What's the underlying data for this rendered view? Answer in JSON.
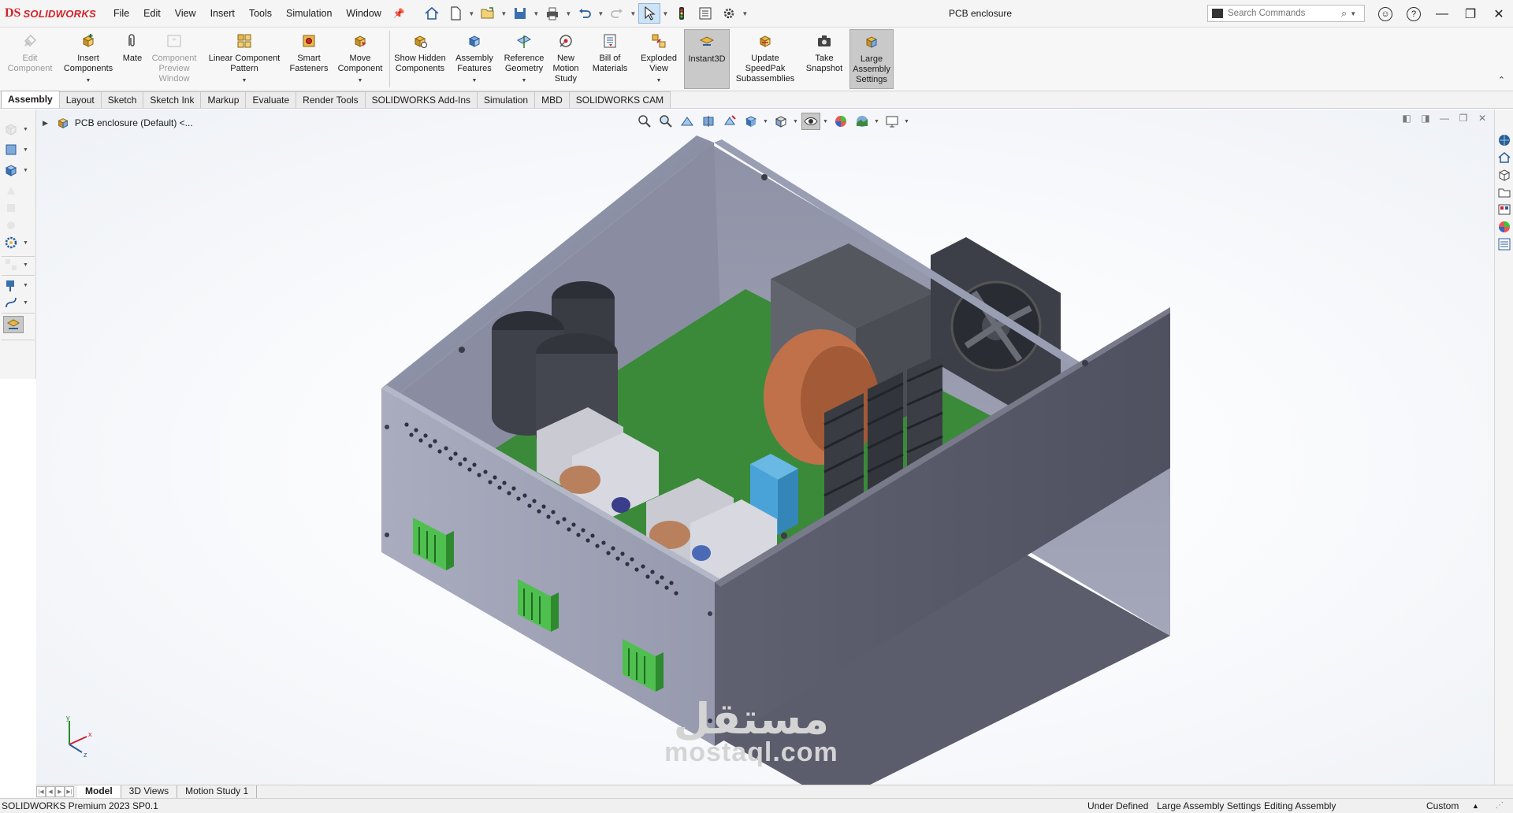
{
  "app": {
    "brand_mark": "DS",
    "brand_name": "SOLIDWORKS"
  },
  "menu": [
    "File",
    "Edit",
    "View",
    "Insert",
    "Tools",
    "Simulation",
    "Window"
  ],
  "document_title": "PCB enclosure",
  "search": {
    "placeholder": "Search Commands"
  },
  "ribbon": {
    "edit_component": "Edit Component",
    "insert_components": "Insert Components",
    "mate": "Mate",
    "component_preview": "Component Preview Window",
    "linear_pattern": "Linear Component Pattern",
    "smart_fasteners": "Smart Fasteners",
    "move_component": "Move Component",
    "show_hidden": "Show Hidden Components",
    "assembly_features": "Assembly Features",
    "reference_geometry": "Reference Geometry",
    "new_motion_study": "New Motion Study",
    "bill_of_materials": "Bill of Materials",
    "exploded_view": "Exploded View",
    "instant3d": "Instant3D",
    "update_speedpak": "Update SpeedPak Subassemblies",
    "take_snapshot": "Take Snapshot",
    "large_assembly": "Large Assembly Settings"
  },
  "tabs": [
    "Assembly",
    "Layout",
    "Sketch",
    "Sketch Ink",
    "Markup",
    "Evaluate",
    "Render Tools",
    "SOLIDWORKS Add-Ins",
    "Simulation",
    "MBD",
    "SOLIDWORKS CAM"
  ],
  "active_tab": "Assembly",
  "tree": {
    "root_label": "PCB enclosure  (Default) <..."
  },
  "triad": {
    "x": "x",
    "y": "y",
    "z": "z"
  },
  "bottom_tabs": [
    "Model",
    "3D Views",
    "Motion Study 1"
  ],
  "status": {
    "product": "SOLIDWORKS Premium 2023 SP0.1",
    "definition": "Under Defined",
    "large_assembly": "Large Assembly Settings",
    "mode": "Editing Assembly",
    "units": "Custom"
  },
  "watermark": {
    "arabic": "مستقل",
    "latin": "mostaql.com"
  },
  "colors": {
    "enclosure_top": "#8a8ea3",
    "enclosure_side": "#5a5c6b",
    "pcb": "#3a8a3a",
    "terminal": "#4fbf4f",
    "inductor": "#c0714a",
    "capacitor": "#3a3c44",
    "relay_blue": "#4aa3d8",
    "brand_red": "#d2232a"
  }
}
